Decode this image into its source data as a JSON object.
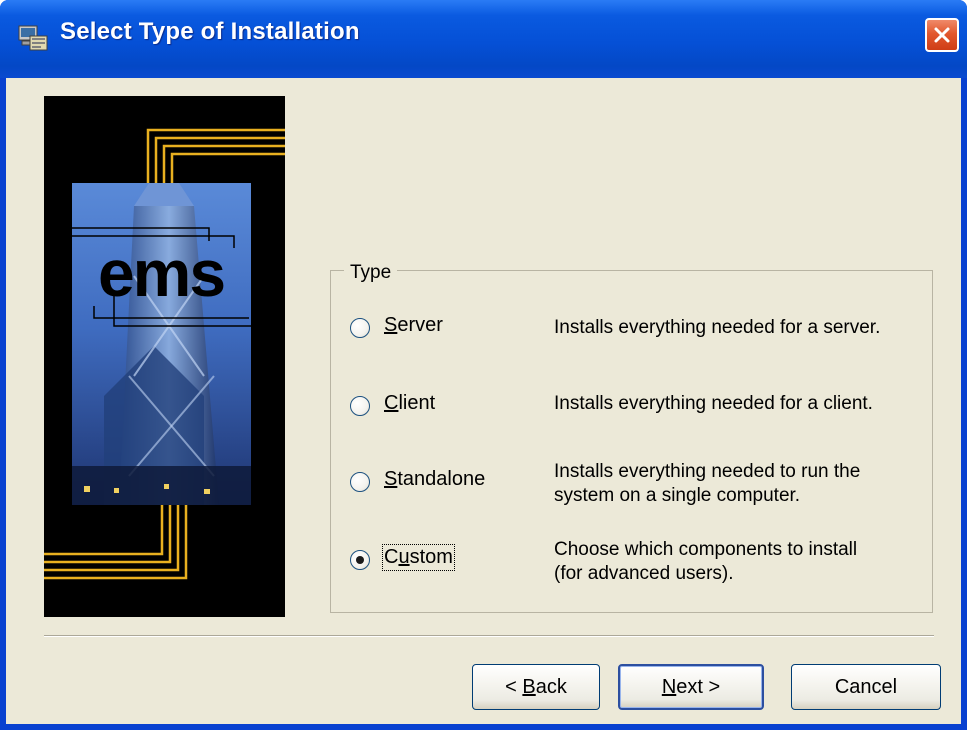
{
  "window": {
    "title": "Select Type of Installation"
  },
  "banner": {
    "logo_text": "ems"
  },
  "group": {
    "legend": "Type",
    "options": [
      {
        "label": "Server",
        "mnemonic": "S",
        "rest": "erver",
        "description": [
          "Installs everything needed for a server."
        ],
        "selected": false
      },
      {
        "label": "Client",
        "mnemonic": "C",
        "rest": "lient",
        "description": [
          "Installs everything needed for a client."
        ],
        "selected": false
      },
      {
        "label": "Standalone",
        "mnemonic": "S",
        "rest": "tandalone",
        "description": [
          "Installs everything needed to run the",
          "system on a single computer."
        ],
        "selected": false
      },
      {
        "label": "Custom",
        "mnemonic": "u",
        "pre": "C",
        "rest": "stom",
        "description": [
          "Choose which components to install",
          "(for advanced users)."
        ],
        "selected": true
      }
    ]
  },
  "buttons": {
    "back": {
      "prefix": "< ",
      "mnemonic": "B",
      "rest": "ack"
    },
    "next": {
      "mnemonic": "N",
      "rest": "ext >"
    },
    "cancel": {
      "label": "Cancel"
    }
  },
  "colors": {
    "titlebar": "#0550d6",
    "dialog_bg": "#ece9d8",
    "close_button": "#e2582e",
    "banner_gold": "#e8b020"
  }
}
